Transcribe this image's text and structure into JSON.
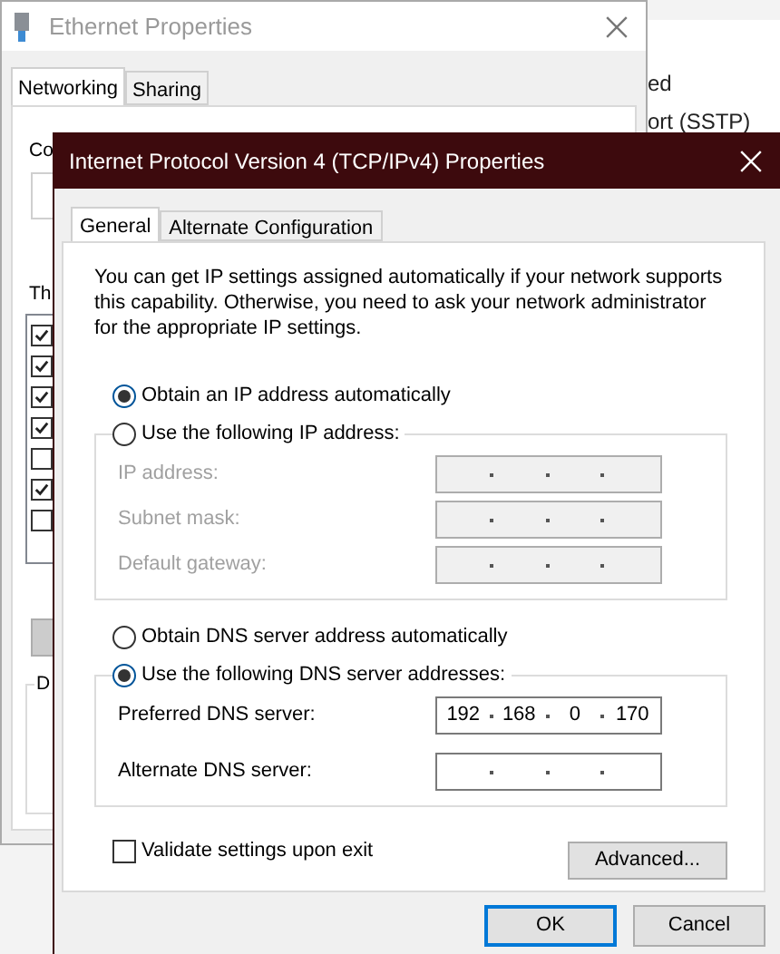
{
  "back_window": {
    "title": "Ethernet Properties",
    "tabs": [
      {
        "label": "Networking",
        "selected": true
      },
      {
        "label": "Sharing",
        "selected": false
      }
    ],
    "connect_label": "Co",
    "list_label": "Th",
    "items": [
      {
        "checked": true
      },
      {
        "checked": true
      },
      {
        "checked": true
      },
      {
        "checked": true
      },
      {
        "checked": false
      },
      {
        "checked": true
      },
      {
        "checked": false
      }
    ],
    "group_label": "D"
  },
  "far_window": {
    "lines": [
      "ed",
      "ort (SSTP)"
    ]
  },
  "dialog": {
    "title": "Internet Protocol Version 4 (TCP/IPv4) Properties",
    "tabs": [
      {
        "label": "General",
        "selected": true
      },
      {
        "label": "Alternate Configuration",
        "selected": false
      }
    ],
    "intro": "You can get IP settings assigned automatically if your network supports this capability. Otherwise, you need to ask your network administrator for the appropriate IP settings.",
    "ip_options": [
      {
        "label": "Obtain an IP address automatically",
        "selected": true
      },
      {
        "label": "Use the following IP address:",
        "selected": false
      }
    ],
    "ip_fields": [
      {
        "label": "IP address:",
        "disabled": true
      },
      {
        "label": "Subnet mask:",
        "disabled": true
      },
      {
        "label": "Default gateway:",
        "disabled": true
      }
    ],
    "dns_options": [
      {
        "label": "Obtain DNS server address automatically",
        "selected": false
      },
      {
        "label": "Use the following DNS server addresses:",
        "selected": true
      }
    ],
    "dns_fields": [
      {
        "label": "Preferred DNS server:",
        "disabled": false,
        "octets": [
          "192",
          "168",
          "0",
          "170"
        ]
      },
      {
        "label": "Alternate DNS server:",
        "disabled": false
      }
    ],
    "validate": {
      "label": "Validate settings upon exit",
      "checked": false
    },
    "advanced_button": "Advanced...",
    "buttons": [
      {
        "label": "OK",
        "default": true
      },
      {
        "label": "Cancel",
        "default": false
      }
    ]
  }
}
